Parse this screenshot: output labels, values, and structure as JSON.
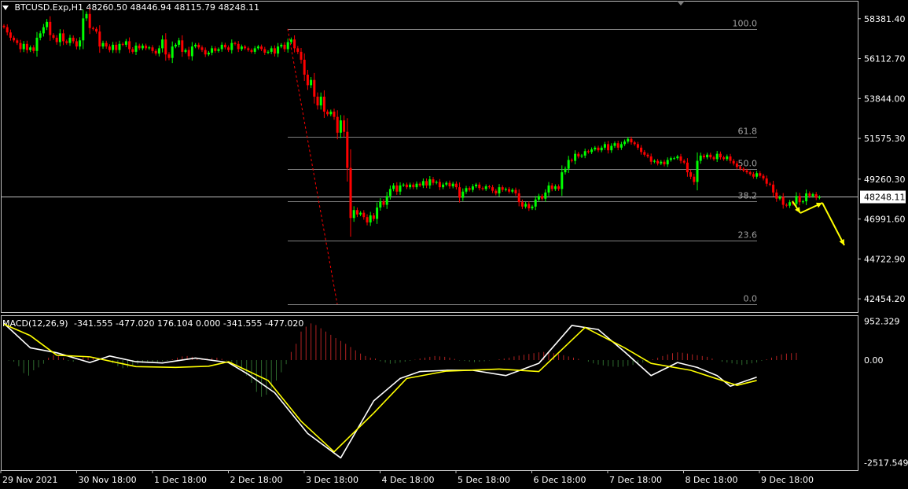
{
  "header": {
    "symbol": "BTCUSD.Exp,H1",
    "ohlc": "48260.50 48446.94 48115.79 48248.11"
  },
  "macd_header": {
    "name": "MACD(12,26,9)",
    "values": "-341.555 -477.020 176.104 0.000 -341.555 -477.020"
  },
  "colors": {
    "background": "#000000",
    "bull": "#00ff00",
    "bear": "#ff0000",
    "grid": "#c0c0c0",
    "fib": "#808080",
    "macd_main": "#ffffff",
    "macd_signal": "#ffff00",
    "hist_up": "#b22222",
    "hist_down": "#2e6b2e",
    "arrow": "#ffff00"
  },
  "chart_data": [
    {
      "type": "candlestick",
      "title": "BTCUSD.Exp,H1",
      "price_axis_labels": [
        "58381.40",
        "56112.70",
        "53844.00",
        "51575.30",
        "49260.30",
        "46991.60",
        "44722.90",
        "42454.20"
      ],
      "price_axis_values": [
        58381.4,
        56112.7,
        53844.0,
        51575.3,
        49260.3,
        46991.6,
        44722.9,
        42454.2
      ],
      "current_price_label": "48248.11",
      "current_price": 48248.11,
      "ylim": [
        41700,
        59400
      ],
      "x_labels": [
        "29 Nov 2021",
        "30 Nov 18:00",
        "1 Dec 18:00",
        "2 Dec 18:00",
        "3 Dec 18:00",
        "4 Dec 18:00",
        "5 Dec 18:00",
        "6 Dec 18:00",
        "7 Dec 18:00",
        "8 Dec 18:00",
        "9 Dec 18:00"
      ],
      "closes": [
        57900,
        57600,
        57300,
        57150,
        57000,
        56650,
        56950,
        56600,
        56750,
        56550,
        57300,
        57550,
        57900,
        58200,
        57450,
        57300,
        57050,
        57550,
        57100,
        57000,
        57300,
        57100,
        56800,
        57150,
        58400,
        58650,
        57850,
        57800,
        57650,
        56800,
        57000,
        56800,
        56600,
        56900,
        56600,
        56950,
        56900,
        57100,
        56650,
        56500,
        56850,
        56700,
        56850,
        56700,
        56750,
        56550,
        56400,
        56700,
        57200,
        56350,
        56150,
        56800,
        56900,
        57150,
        56500,
        56600,
        56250,
        56800,
        56900,
        56750,
        56600,
        56350,
        56450,
        56700,
        56550,
        56650,
        56900,
        56750,
        56600,
        57000,
        56950,
        56650,
        56800,
        56700,
        56600,
        56500,
        56700,
        56800,
        56650,
        56450,
        56500,
        56700,
        56400,
        56800,
        56900,
        56650,
        57050,
        57200,
        56700,
        56500,
        56050,
        55200,
        54600,
        54900,
        53950,
        53450,
        53950,
        53100,
        52950,
        53100,
        52800,
        51900,
        52600,
        51950,
        49900,
        47050,
        47500,
        47250,
        47350,
        47100,
        46800,
        47200,
        47000,
        47650,
        48000,
        47800,
        48300,
        48700,
        48900,
        48550,
        48900,
        48950,
        48800,
        48950,
        48800,
        49000,
        48900,
        49150,
        48900,
        49250,
        49050,
        49100,
        48800,
        48950,
        49050,
        48850,
        49000,
        48800,
        48200,
        48550,
        48750,
        48650,
        48850,
        48950,
        48750,
        48700,
        48850,
        48800,
        48600,
        48450,
        48800,
        48650,
        48700,
        48550,
        48650,
        48450,
        47950,
        47700,
        47850,
        47600,
        47700,
        48100,
        48300,
        48150,
        48500,
        48900,
        48700,
        48850,
        48700,
        49650,
        49850,
        50350,
        50300,
        50700,
        50550,
        50600,
        50850,
        50800,
        50950,
        51050,
        50900,
        51050,
        51250,
        50900,
        51150,
        51300,
        51050,
        51250,
        51400,
        51550,
        51350,
        51250,
        51050,
        50800,
        50650,
        50550,
        50250,
        50300,
        50150,
        50250,
        50100,
        50350,
        50450,
        50450,
        50550,
        50300,
        50200,
        49650,
        49400,
        49100,
        50300,
        50600,
        50500,
        50650,
        50500,
        50400,
        50700,
        50500,
        50400,
        50550,
        50300,
        50150,
        49950,
        49850,
        49750,
        49650,
        49550,
        49400,
        49600,
        49450,
        49300,
        49000,
        48950,
        48500,
        48150,
        48250,
        47800,
        47750,
        47950,
        47850,
        48300,
        47950,
        48000,
        48450,
        48300,
        48400,
        48200,
        48248
      ],
      "fibonacci": {
        "levels": [
          {
            "label": "100.0",
            "price": 57800
          },
          {
            "label": "61.8",
            "price": 51650
          },
          {
            "label": "50.0",
            "price": 49850
          },
          {
            "label": "38.2",
            "price": 48000
          },
          {
            "label": "23.6",
            "price": 45780
          },
          {
            "label": "0.0",
            "price": 42150
          }
        ]
      }
    },
    {
      "type": "line",
      "title": "MACD(12,26,9)",
      "axis_labels": [
        "952.329",
        "0.00",
        "-2517.549"
      ],
      "axis_values": [
        952.329,
        0.0,
        -2517.549
      ],
      "series": [
        {
          "name": "Main",
          "x": [
            0,
            8,
            16,
            26,
            32,
            40,
            48,
            58,
            68,
            74,
            82,
            92,
            102,
            112,
            120,
            126,
            134,
            142,
            152,
            162,
            172,
            180,
            188,
            196,
            204,
            210,
            216,
            220,
            228
          ],
          "values": [
            900,
            300,
            180,
            -60,
            100,
            -40,
            -70,
            50,
            -60,
            -350,
            -800,
            -1800,
            -2400,
            -1000,
            -450,
            -280,
            -250,
            -250,
            -380,
            -80,
            850,
            750,
            200,
            -380,
            -60,
            -180,
            -380,
            -640,
            -420
          ]
        },
        {
          "name": "Signal",
          "x": [
            0,
            8,
            16,
            26,
            40,
            52,
            62,
            68,
            80,
            90,
            100,
            112,
            122,
            134,
            150,
            162,
            176,
            188,
            196,
            208,
            222,
            228
          ],
          "values": [
            880,
            600,
            120,
            80,
            -160,
            -180,
            -150,
            -40,
            -500,
            -1500,
            -2250,
            -1300,
            -450,
            -270,
            -220,
            -280,
            800,
            300,
            -80,
            -250,
            -620,
            -500
          ]
        }
      ],
      "histogram": [
        0,
        -10,
        -40,
        -150,
        -320,
        -380,
        -250,
        -180,
        -90,
        60,
        120,
        100,
        60,
        -20,
        -40,
        30,
        70,
        80,
        60,
        40,
        20,
        -30,
        -80,
        -150,
        -200,
        -180,
        -140,
        -100,
        -70,
        -60,
        -40,
        -50,
        -30,
        -20,
        20,
        60,
        90,
        100,
        80,
        60,
        40,
        40,
        50,
        60,
        30,
        -10,
        -50,
        -120,
        -220,
        -380,
        -560,
        -780,
        -900,
        -850,
        -700,
        -500,
        -300,
        -100,
        200,
        400,
        700,
        820,
        900,
        860,
        780,
        700,
        620,
        540,
        470,
        400,
        320,
        240,
        160,
        100,
        60,
        40,
        -30,
        -60,
        -90,
        -80,
        -60,
        -40,
        -20,
        10,
        40,
        60,
        80,
        100,
        90,
        80,
        60,
        30,
        -10,
        -20,
        -40,
        -50,
        -40,
        -30,
        -10,
        0,
        20,
        40,
        60,
        90,
        110,
        130,
        150,
        170,
        190,
        200,
        190,
        170,
        150,
        120,
        90,
        60,
        30,
        0,
        -40,
        -80,
        -110,
        -130,
        -150,
        -160,
        -170,
        -160,
        -140,
        -120,
        -90,
        -60,
        -20,
        20,
        60,
        100,
        140,
        170,
        190,
        180,
        160,
        140,
        120,
        100,
        80,
        40,
        0,
        -40,
        -60,
        -80,
        -100,
        -120,
        -100,
        -80,
        -60,
        -20,
        20,
        60,
        100,
        140,
        160,
        170,
        176
      ]
    }
  ]
}
